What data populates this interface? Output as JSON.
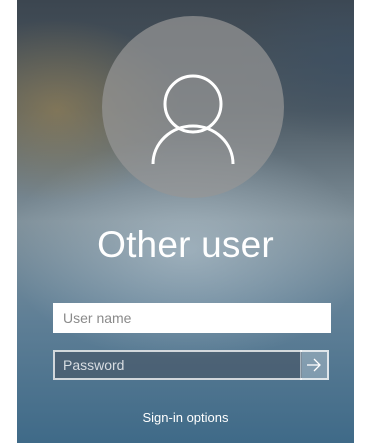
{
  "login": {
    "user_display_name": "Other user",
    "username_placeholder": "User name",
    "username_value": "",
    "password_placeholder": "Password",
    "password_value": "",
    "submit_icon": "arrow-right-icon",
    "signin_options_label": "Sign-in options"
  },
  "avatar": {
    "icon": "user-icon"
  },
  "colors": {
    "avatar_circle": "#969696",
    "text": "#ffffff",
    "background_top": "#3c4650",
    "background_bottom": "#3f6a88"
  }
}
